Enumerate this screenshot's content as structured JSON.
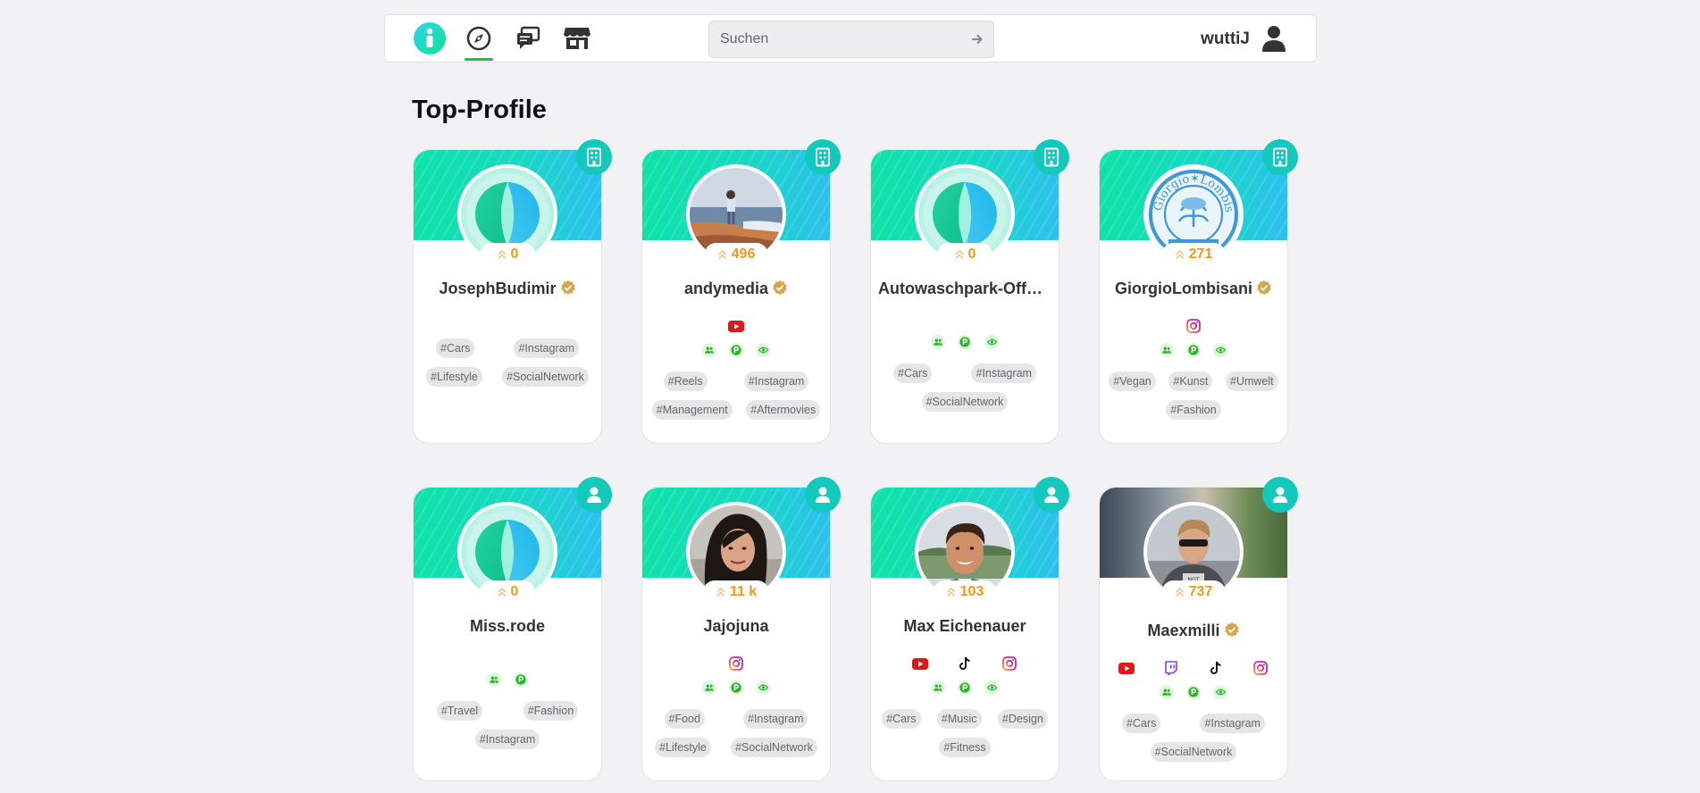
{
  "search": {
    "placeholder": "Suchen"
  },
  "user": {
    "name": "wuttiJ"
  },
  "section": {
    "title": "Top-Profile"
  },
  "colors": {
    "accent": "#1ec337",
    "badge": "#13c9bc",
    "rank": "#f0981a",
    "verified": "#d8a54a"
  },
  "cards": [
    {
      "name": "JosephBudimir",
      "rank": "0",
      "type": "building-icon",
      "verified": true,
      "avatar": "logo",
      "banner": "pattern",
      "socials": [],
      "stats": [],
      "tags": [
        "#Cars",
        "#Instagram",
        "#Lifestyle",
        "#SocialNetwork"
      ]
    },
    {
      "name": "andymedia",
      "rank": "496",
      "type": "building-icon",
      "verified": true,
      "avatar": "beach",
      "banner": "pattern",
      "socials": [
        "youtube-icon"
      ],
      "stats": [
        "people-icon",
        "p-icon",
        "eye-icon"
      ],
      "tags": [
        "#Reels",
        "#Instagram",
        "#Management",
        "#Aftermovies"
      ]
    },
    {
      "name": "Autowaschpark-Offenbach",
      "rank": "0",
      "type": "building-icon",
      "verified": false,
      "avatar": "logo",
      "banner": "pattern",
      "socials": [],
      "stats": [
        "people-icon",
        "p-icon",
        "eye-icon"
      ],
      "tags": [
        "#Cars",
        "#Instagram",
        "#SocialNetwork"
      ]
    },
    {
      "name": "GiorgioLombisani",
      "rank": "271",
      "type": "building-icon",
      "verified": true,
      "avatar": "seal",
      "banner": "pattern",
      "socials": [
        "instagram-icon"
      ],
      "stats": [
        "people-icon",
        "p-icon",
        "eye-icon"
      ],
      "tags": [
        "#Vegan",
        "#Kunst",
        "#Umwelt",
        "#Fashion"
      ]
    },
    {
      "name": "Miss.rode",
      "rank": "0",
      "type": "person-icon",
      "verified": false,
      "avatar": "logo",
      "banner": "pattern",
      "socials": [],
      "stats": [
        "people-icon",
        "p-icon"
      ],
      "tags": [
        "#Travel",
        "#Fashion",
        "#Instagram"
      ]
    },
    {
      "name": "Jajojuna",
      "rank": "11 k",
      "type": "person-icon",
      "verified": false,
      "avatar": "woman",
      "banner": "pattern",
      "socials": [
        "instagram-icon"
      ],
      "stats": [
        "people-icon",
        "p-icon",
        "eye-icon"
      ],
      "tags": [
        "#Food",
        "#Instagram",
        "#Lifestyle",
        "#SocialNetwork"
      ]
    },
    {
      "name": "Max Eichenauer",
      "rank": "103",
      "type": "person-icon",
      "verified": false,
      "avatar": "man",
      "banner": "pattern",
      "socials": [
        "youtube-icon",
        "tiktok-icon",
        "instagram-icon"
      ],
      "stats": [
        "people-icon",
        "p-icon",
        "eye-icon"
      ],
      "tags": [
        "#Cars",
        "#Music",
        "#Design",
        "#Fitness"
      ]
    },
    {
      "name": "Maexmilli",
      "rank": "737",
      "type": "person-icon",
      "verified": true,
      "avatar": "man2",
      "banner": "photo",
      "socials": [
        "youtube-icon",
        "twitch-icon",
        "tiktok-icon",
        "instagram-icon"
      ],
      "stats": [
        "people-icon",
        "p-icon",
        "eye-icon"
      ],
      "tags": [
        "#Cars",
        "#Instagram",
        "#SocialNetwork"
      ]
    }
  ]
}
